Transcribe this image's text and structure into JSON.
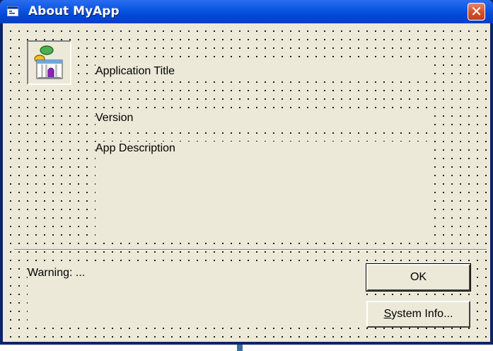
{
  "window": {
    "title": "About MyApp",
    "icon": "form-icon",
    "close_label": "✕"
  },
  "form": {
    "app_icon": "application-icon",
    "title_label": "Application Title",
    "version_label": "Version",
    "description_label": "App Description",
    "warning_label": "Warning: ..."
  },
  "buttons": {
    "ok_label": "OK",
    "system_info_prefix": "S",
    "system_info_rest": "ystem Info..."
  },
  "colors": {
    "titlebar": "#0046d5",
    "client": "#ece9d8",
    "close": "#d6502c"
  }
}
